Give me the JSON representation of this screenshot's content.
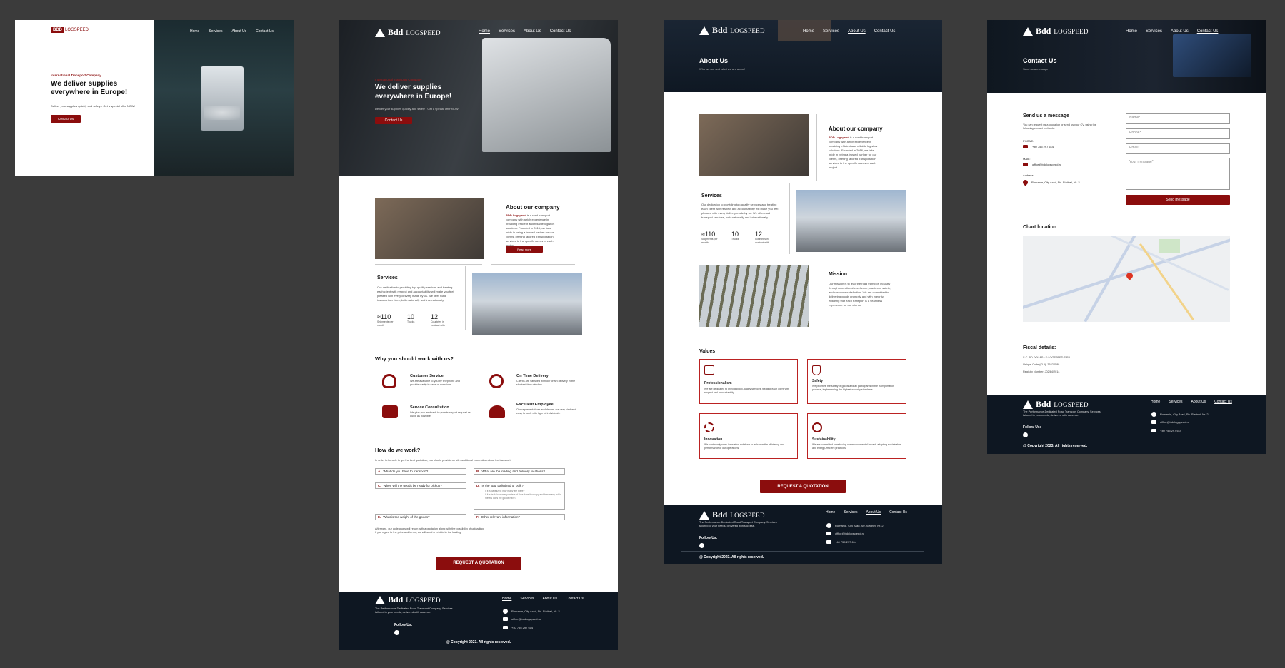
{
  "brand": {
    "logo_bold": "Bdd",
    "logo_text": "LOGSPEED",
    "logo_small": "BDD LOGSPEED"
  },
  "nav": {
    "home": "Home",
    "services": "Services",
    "about": "About Us",
    "contact": "Contact Us"
  },
  "hero": {
    "eyebrow": "International Transport Company",
    "title_line1": "We deliver supplies",
    "title_line2": "everywhere in Europe!",
    "subtitle": "Deliver your supplies quickly and safely - Get a special offer NOW!",
    "cta": "Contact Us"
  },
  "about": {
    "title": "About our company",
    "lead_brand": "BDD Logspeed",
    "text": " is a road transport company with a rich experience in providing efficient and reliable logistics solutions. Founded in 2016, we take pride in being a trusted partner for our clients, offering tailored transportation services to the specific needs of each project.",
    "read_more": "Read more"
  },
  "services": {
    "title": "Services",
    "text": "Our dedication to providing top-quality services and treating each client with respect and accountability will make you feel pleased with every delivery made by us. We offer road transport services, both nationally and internationally.",
    "stats": [
      {
        "value": "≈110",
        "label": "Shipments per month"
      },
      {
        "value": "10",
        "label": "Trucks"
      },
      {
        "value": "12",
        "label": "Countries in contract with"
      }
    ]
  },
  "why": {
    "title": "Why you should work with us?",
    "items": [
      {
        "icon": "headset-icon",
        "title": "Customer Service",
        "text": "We are available to you by telephone and provide clarity in case of questions."
      },
      {
        "icon": "stopwatch-icon",
        "title": "On Time Delivery",
        "text": "Clients are satisfied with our chain delivery in the shortest time window."
      },
      {
        "icon": "chat-icon",
        "title": "Service Consultation",
        "text": "We give you feedback to your transport request as quick as possible."
      },
      {
        "icon": "team-icon",
        "title": "Excellent Employee",
        "text": "Our representatives and drivers are very kind and easy to work with type of individuals."
      }
    ]
  },
  "how": {
    "title": "How do we work?",
    "intro": "In order to be able to get the best quotation, you should provide us with additional information about the transport:",
    "questions": [
      {
        "letter": "A.",
        "text": "What do you have to transport?"
      },
      {
        "letter": "B.",
        "text": "What are the loading and delivery locations?"
      },
      {
        "letter": "C.",
        "text": "When will the goods be ready for pickup?"
      },
      {
        "letter": "D.",
        "text": "Is the load palletized or bulk?"
      },
      {
        "letter": "E.",
        "text": "What is the weight of the goods?"
      },
      {
        "letter": "F.",
        "text": "Other relevant information?"
      }
    ],
    "sub_d1": "If it is palletized: how many are there?",
    "sub_d2": "If it is bulk: how many meters of floor does it occupy and how many cubic meters does the goods have?",
    "outro1": "Afterward, our colleagues will return with a quotation along with the possibility of uploading.",
    "outro2": "If you agree to the price and terms, we will send a vehicle to the loading.",
    "quote_btn": "REQUEST A QUOTATION"
  },
  "footer": {
    "tagline": "The Performance-Dedicated Road Transport Company. Services tailored to your needs, delivered with success.",
    "follow": "Follow Us:",
    "address": "Romania, City Arad, Str. Slatinei, Nr. 2",
    "email": "office@bddlogspeed.ro",
    "phone": "+40 755 297 614",
    "copyright": "@ Copyright 2023. All rights reserved."
  },
  "about_page": {
    "title": "About Us",
    "subtitle": "Who we are and what we are about!",
    "mission_title": "Mission",
    "mission_text": "Our mission is to lead the road transport industry through operational excellence, maximum safety, and customer satisfaction. We are committed to delivering goods promptly and with integrity, ensuring that each transport is a seamless experience for our clients.",
    "values_title": "Values",
    "values": [
      {
        "icon": "calendar-icon",
        "title": "Professionalism",
        "text": "We are dedicated to providing top-quality services, treating each client with respect and accountability."
      },
      {
        "icon": "shield-check-icon",
        "title": "Safety",
        "text": "We prioritize the safety of goods and all participants in the transportation process, implementing the highest security standards."
      },
      {
        "icon": "gear-icon",
        "title": "Innovation",
        "text": "We continually seek innovative solutions to enhance the efficiency and performance of our operations."
      },
      {
        "icon": "recycle-icon",
        "title": "Sustainability",
        "text": "We are committed to reducing our environmental impact, adopting sustainable and energy-efficient practices."
      }
    ]
  },
  "contact_page": {
    "title": "Contact Us",
    "subtitle": "Send us a message",
    "send_title": "Send us a message",
    "send_text": "You can request us a quotation or send us your CV, using the following contact methods:",
    "phone_label": "PHONE:",
    "mail_label": "MAIL:",
    "address_label": "Address:",
    "fields": {
      "name": "Name*",
      "phone": "Phone*",
      "email": "Email*",
      "message": "Your message*"
    },
    "send_btn": "Send message",
    "location_title": "Chart location:",
    "fiscal_title": "Fiscal details:",
    "fiscal_1": "S.C. BD DOUASA D LOGSPEED S.R.L.",
    "fiscal_2": "Unique Code (CUI): 35422589",
    "fiscal_3": "Registry Number: J02/84/2014"
  },
  "colors": {
    "accent": "#8b0d0d",
    "dark": "#0e1722",
    "canvas": "#3b3b3b"
  }
}
